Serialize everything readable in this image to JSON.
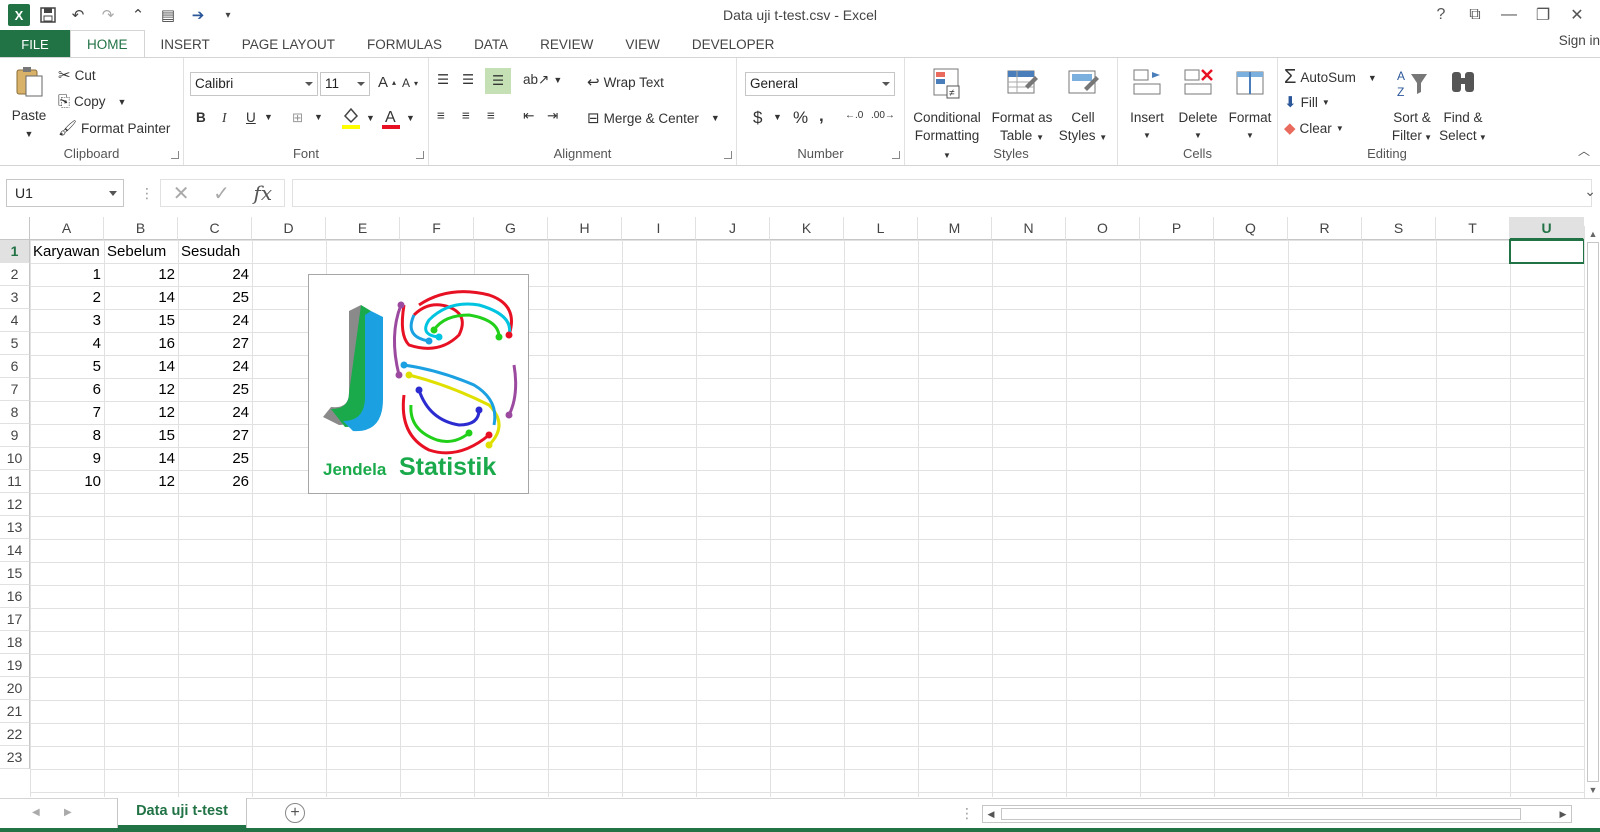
{
  "window": {
    "title": "Data uji t-test.csv - Excel",
    "sign_in": "Sign in"
  },
  "ribbon_tabs": [
    "FILE",
    "HOME",
    "INSERT",
    "PAGE LAYOUT",
    "FORMULAS",
    "DATA",
    "REVIEW",
    "VIEW",
    "DEVELOPER"
  ],
  "active_tab": "HOME",
  "clipboard": {
    "label": "Clipboard",
    "paste": "Paste",
    "cut": "Cut",
    "copy": "Copy",
    "format_painter": "Format Painter"
  },
  "font": {
    "label": "Font",
    "name": "Calibri",
    "size": "11",
    "bold": "B",
    "italic": "I",
    "underline": "U",
    "font_color": "#e81123",
    "highlight_color": "#ffff00"
  },
  "alignment": {
    "label": "Alignment",
    "wrap_text": "Wrap Text",
    "merge_center": "Merge & Center"
  },
  "number": {
    "label": "Number",
    "format": "General",
    "currency": "$",
    "percent": "%",
    "comma": ","
  },
  "styles": {
    "label": "Styles",
    "conditional_1": "Conditional",
    "conditional_2": "Formatting",
    "format_table_1": "Format as",
    "format_table_2": "Table",
    "cell_styles_1": "Cell",
    "cell_styles_2": "Styles"
  },
  "cells": {
    "label": "Cells",
    "insert": "Insert",
    "delete": "Delete",
    "format": "Format"
  },
  "editing": {
    "label": "Editing",
    "autosum": "AutoSum",
    "fill": "Fill",
    "clear": "Clear",
    "sort_1": "Sort &",
    "sort_2": "Filter",
    "find_1": "Find &",
    "find_2": "Select"
  },
  "formula_bar": {
    "name_box": "U1",
    "formula": "",
    "fx": "fx"
  },
  "columns": [
    "A",
    "B",
    "C",
    "D",
    "E",
    "F",
    "G",
    "H",
    "I",
    "J",
    "K",
    "L",
    "M",
    "N",
    "O",
    "P",
    "Q",
    "R",
    "S",
    "T",
    "U"
  ],
  "selected_column": "U",
  "rows": [
    "1",
    "2",
    "3",
    "4",
    "5",
    "6",
    "7",
    "8",
    "9",
    "10",
    "11",
    "12",
    "13",
    "14",
    "15",
    "16",
    "17",
    "18",
    "19",
    "20",
    "21",
    "22",
    "23"
  ],
  "selected_row": "1",
  "sheet_header": [
    "Karyawan",
    "Sebelum",
    "Sesudah"
  ],
  "sheet_rows": [
    [
      1,
      12,
      24
    ],
    [
      2,
      14,
      25
    ],
    [
      3,
      15,
      24
    ],
    [
      4,
      16,
      27
    ],
    [
      5,
      14,
      24
    ],
    [
      6,
      12,
      25
    ],
    [
      7,
      12,
      24
    ],
    [
      8,
      15,
      27
    ],
    [
      9,
      14,
      25
    ],
    [
      10,
      12,
      26
    ]
  ],
  "logo": {
    "word1": "Jendela",
    "word2": "Statistik",
    "brand_color": "#1aaa4b"
  },
  "sheet_tabs": [
    "Data uji t-test"
  ],
  "accent_color": "#217346"
}
